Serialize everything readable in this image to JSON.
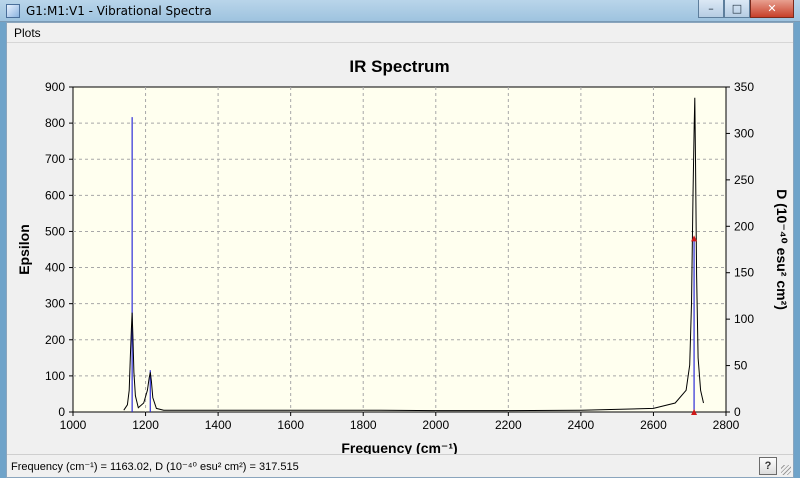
{
  "window": {
    "title": "G1:M1:V1 - Vibrational Spectra",
    "minimize_glyph": "–",
    "maximize_glyph": "□",
    "close_glyph": "✕"
  },
  "menu": {
    "items": [
      "Plots"
    ]
  },
  "status": {
    "text": "Frequency (cm⁻¹) = 1163.02, D (10⁻⁴⁰ esu² cm²) = 317.515",
    "help_glyph": "?"
  },
  "icons": {
    "app": "spectrum-window-icon",
    "help": "help-icon"
  },
  "colors": {
    "spectrum_line": "#000000",
    "stick": "#2d2dd8",
    "marker": "#d01818",
    "grid": "#a8a8a8",
    "plot_bg": "#ffffef"
  },
  "chart_data": {
    "type": "line",
    "title": "IR Spectrum",
    "xlabel": "Frequency (cm⁻¹)",
    "ylabel": "Epsilon",
    "y2label": "D (10⁻⁴⁰ esu² cm²)",
    "xlim": [
      1000,
      2800
    ],
    "ylim": [
      0,
      900
    ],
    "y2lim": [
      0,
      350
    ],
    "xticks": [
      1000,
      1200,
      1400,
      1600,
      1800,
      2000,
      2200,
      2400,
      2600,
      2800
    ],
    "yticks": [
      0,
      100,
      200,
      300,
      400,
      500,
      600,
      700,
      800,
      900
    ],
    "y2ticks": [
      0,
      50,
      100,
      150,
      200,
      250,
      300,
      350
    ],
    "grid": true,
    "series": [
      {
        "kind": "spectrum",
        "x": [
          1140,
          1150,
          1155,
          1158,
          1161,
          1163,
          1165,
          1168,
          1172,
          1180,
          1195,
          1205,
          1210,
          1213,
          1216,
          1220,
          1230,
          1250,
          1400,
          1560,
          1800,
          2000,
          2200,
          2400,
          2600,
          2660,
          2690,
          2700,
          2705,
          2709,
          2712,
          2714,
          2716,
          2719,
          2723,
          2730,
          2738
        ],
        "y": [
          5,
          20,
          60,
          150,
          230,
          275,
          210,
          110,
          45,
          12,
          25,
          60,
          95,
          110,
          85,
          40,
          10,
          5,
          5,
          5,
          5,
          4,
          4,
          5,
          10,
          25,
          60,
          130,
          300,
          600,
          780,
          870,
          700,
          380,
          150,
          60,
          25
        ]
      },
      {
        "kind": "sticks",
        "x": [
          1163.02,
          1213,
          2712
        ],
        "y2": [
          317.515,
          45,
          187
        ]
      }
    ],
    "markers": [
      {
        "x": 2712,
        "y2": 187
      },
      {
        "x": 2712,
        "y2": 0
      }
    ]
  }
}
